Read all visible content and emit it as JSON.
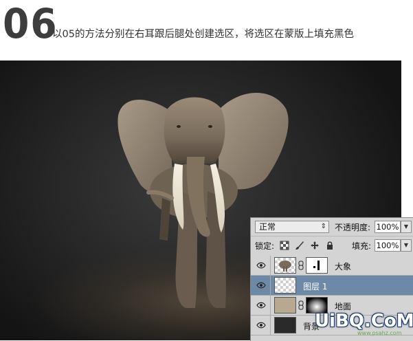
{
  "header": {
    "step_number": "06",
    "instruction": "以05的方法分别在右耳跟后腿处创建选区，将选区在蒙版上填充黑色"
  },
  "layers_panel": {
    "blend_mode": "正常",
    "opacity_label": "不透明度:",
    "opacity_value": "100%",
    "lock_label": "锁定:",
    "fill_label": "填充:",
    "fill_value": "100%",
    "layers": [
      {
        "name": "大象",
        "selected": false,
        "has_mask": true
      },
      {
        "name": "图层 1",
        "selected": true,
        "has_mask": false
      },
      {
        "name": "地面",
        "selected": false,
        "has_mask": true
      },
      {
        "name": "背景",
        "selected": false,
        "has_mask": false
      }
    ],
    "icons": [
      "lock-transparent-icon",
      "lock-paint-icon",
      "lock-move-icon",
      "lock-all-icon",
      "eye-icon",
      "chain-icon"
    ]
  },
  "watermark": {
    "logo": "UiBQ.CoM",
    "url": "www.psahz.com"
  },
  "colors": {
    "selected_layer": "#6c8aa8",
    "panel_bg": "#d4d4d4",
    "step_number": "#3d3d3d"
  }
}
